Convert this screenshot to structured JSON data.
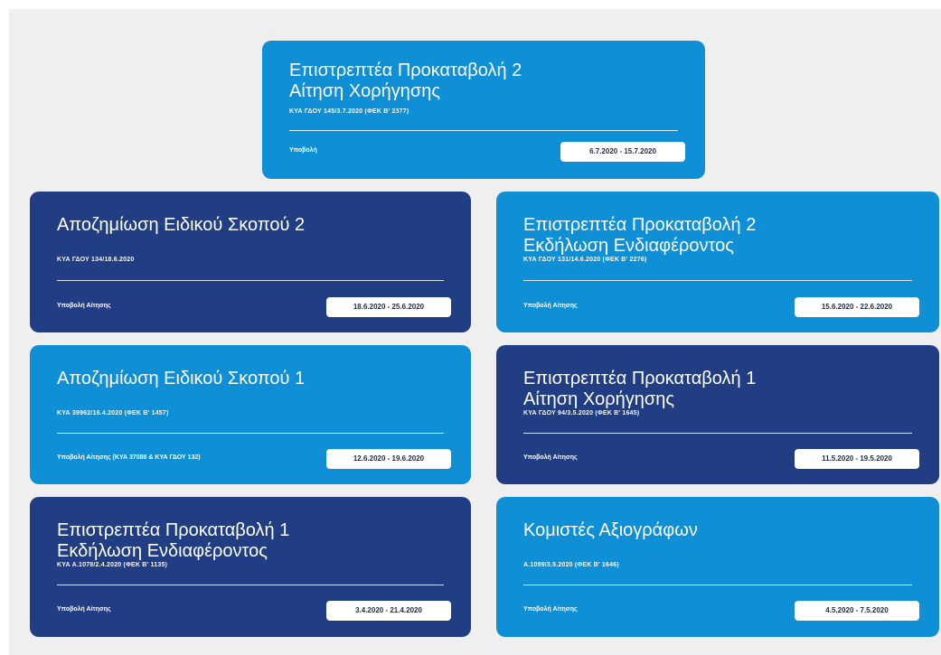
{
  "cards": [
    {
      "title": "Επιστρεπτέα Προκαταβολή 2\nΑίτηση Χορήγησης",
      "ref": "ΚΥΑ ΓΔΟΥ 145/3.7.2020 (ΦΕΚ Β' 2377)",
      "submit": "Υποβολή",
      "dates": "6.7.2020 - 15.7.2020",
      "color": "#0f8fd6"
    },
    {
      "title": "Αποζημίωση Ειδικού Σκοπού 2",
      "ref": "ΚΥΑ ΓΔΟΥ 134/18.6.2020",
      "submit": "Υποβολή Αίτησης",
      "dates": "18.6.2020 - 25.6.2020",
      "color": "#213e84"
    },
    {
      "title": "Επιστρεπτέα Προκαταβολή 2\nΕκδήλωση Ενδιαφέροντος",
      "ref": "ΚΥΑ ΓΔΟΥ 131/14.6.2020 (ΦΕΚ Β' 2276)",
      "submit": "Υποβολή Αίτησης",
      "dates": "15.6.2020 - 22.6.2020",
      "color": "#0f8fd6"
    },
    {
      "title": "Αποζημίωση Ειδικού Σκοπού 1",
      "ref": "ΚΥΑ 39962/16.4.2020 (ΦΕΚ Β' 1457)",
      "submit": "Υποβολή Αίτησης (ΚΥΑ 37088 & ΚΥΑ ΓΔΟΥ 132)",
      "dates": "12.6.2020 - 19.6.2020",
      "color": "#0f8fd6"
    },
    {
      "title": "Επιστρεπτέα Προκαταβολή 1\nΑίτηση Χορήγησης",
      "ref": "ΚΥΑ ΓΔΟΥ 94/3.5.2020 (ΦΕΚ Β' 1645)",
      "submit": "Υποβολή Αίτησης",
      "dates": "11.5.2020 - 19.5.2020",
      "color": "#213e84"
    },
    {
      "title": "Επιστρεπτέα Προκαταβολή 1\nΕκδήλωση Ενδιαφέροντος",
      "ref": "ΚΥΑ Α.1078/2.4.2020 (ΦΕΚ Β' 1135)",
      "submit": "Υποβολή Αίτησης",
      "dates": "3.4.2020 - 21.4.2020",
      "color": "#213e84"
    },
    {
      "title": "Κομιστές Αξιογράφων",
      "ref": "Α.1099/3.5.2020 (ΦΕΚ Β' 1646)",
      "submit": "Υποβολή Αίτησης",
      "dates": "4.5.2020 - 7.5.2020",
      "color": "#0f8fd6"
    }
  ]
}
